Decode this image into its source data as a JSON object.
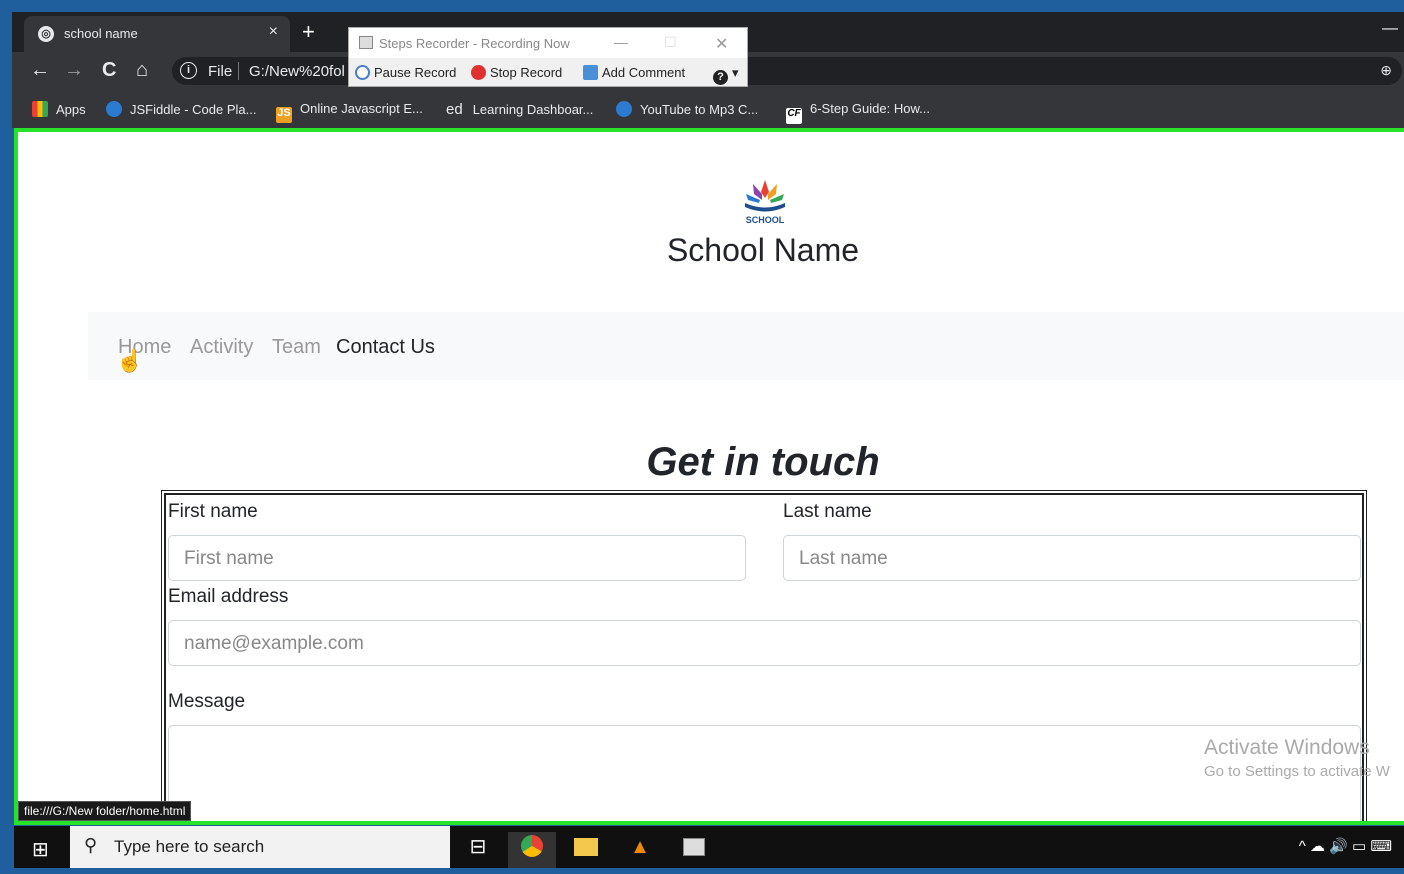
{
  "browser": {
    "tab_title": "school name",
    "tab_close": "×",
    "new_tab": "+",
    "back": "←",
    "forward": "→",
    "reload": "C",
    "home": "⌂",
    "info": "i",
    "file_label": "File",
    "url": "G:/New%20fol",
    "zoom": "⊕",
    "bookmarks": [
      {
        "label": "Apps",
        "color": "#e94235"
      },
      {
        "label": "JSFiddle - Code Pla...",
        "color": "#2b7bd1"
      },
      {
        "label": "Online Javascript E...",
        "color": "#f0a020"
      },
      {
        "label": "Learning Dashboar...",
        "color": "#35363a"
      },
      {
        "label": "YouTube to Mp3 C...",
        "color": "#2b7bd1"
      },
      {
        "label": "6-Step Guide: How...",
        "color": "#ffffff"
      }
    ],
    "bookmark_ed": "ed",
    "bookmark_js": "JS",
    "bookmark_cf": "CF"
  },
  "steps_recorder": {
    "title": "Steps Recorder - Recording Now",
    "pause": "Pause Record",
    "stop": "Stop Record",
    "comment": "Add Comment",
    "help": "?"
  },
  "page": {
    "logo_text": "SCHOOL",
    "school_name": "School Name",
    "nav": [
      "Home",
      "Activity",
      "Team",
      "Contact Us"
    ],
    "heading": "Get in touch",
    "form": {
      "first_name_label": "First name",
      "first_name_placeholder": "First name",
      "last_name_label": "Last name",
      "last_name_placeholder": "Last name",
      "email_label": "Email address",
      "email_placeholder": "name@example.com",
      "message_label": "Message"
    },
    "watermark_line1": "Activate Windows",
    "watermark_line2": "Go to Settings to activate W",
    "status_url": "file:///G:/New folder/home.html"
  },
  "taskbar": {
    "search_placeholder": "Type here to search",
    "tray": "^ ☁ 🔊 ▭ ⌨"
  },
  "colors": {
    "accent_green": "#27e32a",
    "frame_blue": "#1f5f9e"
  }
}
